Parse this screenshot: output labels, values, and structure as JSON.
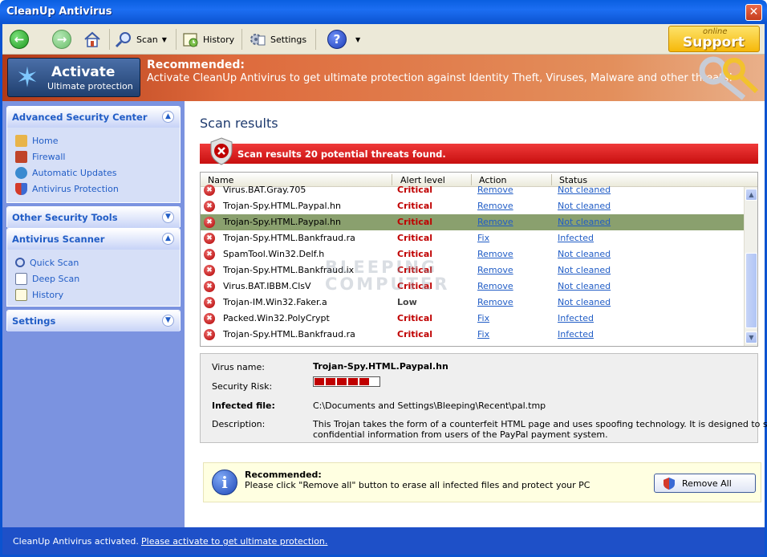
{
  "window": {
    "title": "CleanUp Antivirus",
    "close_glyph": "✕"
  },
  "toolbar": {
    "scan_label": "Scan",
    "history_label": "History",
    "settings_label": "Settings",
    "help_glyph": "?",
    "support_small": "online",
    "support_big": "Support"
  },
  "banner": {
    "activate_title": "Activate",
    "activate_sub": "Ultimate protection",
    "rec_title": "Recommended:",
    "rec_text": "Activate CleanUp Antivirus to get ultimate protection against Identity Theft, Viruses, Malware and other threats!"
  },
  "sidebar": {
    "security_center": {
      "title": "Advanced Security Center",
      "items": [
        {
          "label": "Home",
          "icon": "house-icon"
        },
        {
          "label": "Firewall",
          "icon": "firewall-icon"
        },
        {
          "label": "Automatic Updates",
          "icon": "updates-icon"
        },
        {
          "label": "Antivirus Protection",
          "icon": "shield-icon"
        }
      ]
    },
    "other_tools": {
      "title": "Other Security Tools"
    },
    "scanner": {
      "title": "Antivirus Scanner",
      "items": [
        {
          "label": "Quick Scan",
          "icon": "magnifier-icon"
        },
        {
          "label": "Deep Scan",
          "icon": "document-scan-icon"
        },
        {
          "label": "History",
          "icon": "history-icon"
        }
      ]
    },
    "settings": {
      "title": "Settings"
    }
  },
  "main": {
    "title": "Scan results",
    "alert": "Scan results 20 potential threats found.",
    "columns": [
      "Name",
      "Alert level",
      "Action",
      "Status"
    ],
    "rows": [
      {
        "name": "Virus.BAT.Gray.705",
        "level": "Critical",
        "action": "Remove",
        "status": "Not cleaned"
      },
      {
        "name": "Trojan-Spy.HTML.Paypal.hn",
        "level": "Critical",
        "action": "Remove",
        "status": "Not cleaned"
      },
      {
        "name": "Trojan-Spy.HTML.Paypal.hn",
        "level": "Critical",
        "action": "Remove",
        "status": "Not cleaned",
        "selected": true
      },
      {
        "name": "Trojan-Spy.HTML.Bankfraud.ra",
        "level": "Critical",
        "action": "Fix",
        "status": "Infected"
      },
      {
        "name": "SpamTool.Win32.Delf.h",
        "level": "Critical",
        "action": "Remove",
        "status": "Not cleaned"
      },
      {
        "name": "Trojan-Spy.HTML.Bankfraud.ix",
        "level": "Critical",
        "action": "Remove",
        "status": "Not cleaned"
      },
      {
        "name": "Virus.BAT.IBBM.ClsV",
        "level": "Critical",
        "action": "Remove",
        "status": "Not cleaned"
      },
      {
        "name": "Trojan-IM.Win32.Faker.a",
        "level": "Low",
        "action": "Remove",
        "status": "Not cleaned"
      },
      {
        "name": "Packed.Win32.PolyCrypt",
        "level": "Critical",
        "action": "Fix",
        "status": "Infected"
      },
      {
        "name": "Trojan-Spy.HTML.Bankfraud.ra",
        "level": "Critical",
        "action": "Fix",
        "status": "Infected"
      }
    ],
    "watermark_line1": "BLEEPING",
    "watermark_line2": "COMPUTER",
    "details": {
      "virus_name_label": "Virus name:",
      "virus_name": "Trojan-Spy.HTML.Paypal.hn",
      "risk_label": "Security Risk:",
      "risk_level": 5,
      "risk_max": 5,
      "infected_label": "Infected file:",
      "infected_file": "C:\\Documents and Settings\\Bleeping\\Recent\\pal.tmp",
      "desc_label": "Description:",
      "desc_line1": "This Trojan takes the form of a counterfeit HTML page and uses spoofing technology. It is designed to steal",
      "desc_line2": "confidential information from users of the PayPal payment system."
    },
    "recommend": {
      "title": "Recommended:",
      "text": "Please click \"Remove all\" button to erase all infected files and protect your PC",
      "button": "Remove All",
      "info_glyph": "i"
    }
  },
  "statusbar": {
    "left": "CleanUp Antivirus activated.",
    "link": "Please activate to get ultimate protection."
  },
  "colors": {
    "titlebar": "#0b53d0",
    "critical": "#c00000",
    "link": "#215dc6",
    "selected_row": "#8aa06e",
    "alert_bar": "#d81b1b"
  }
}
